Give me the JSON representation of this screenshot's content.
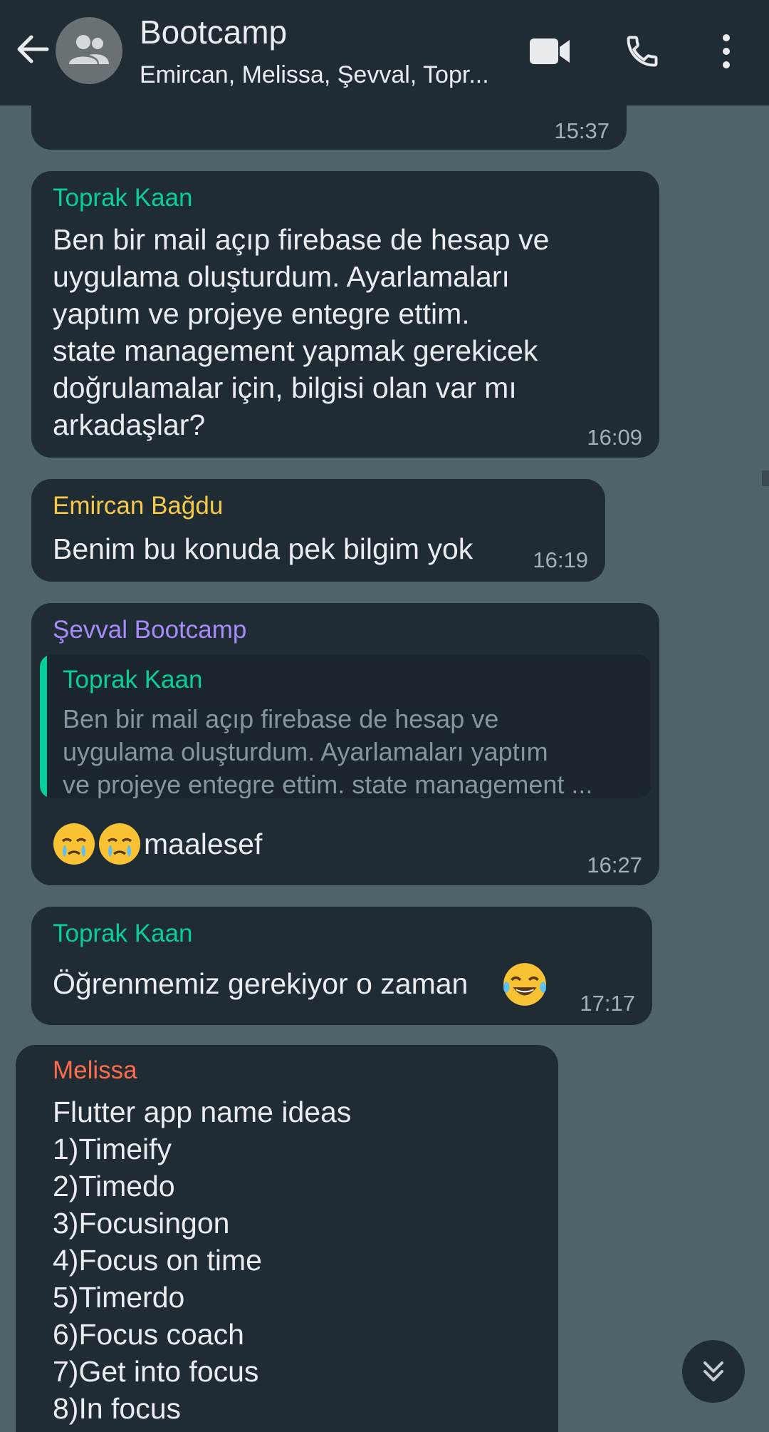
{
  "header": {
    "title": "Bootcamp",
    "subtitle": "Emircan, Melissa, Şevval, Topr...",
    "icons": [
      "back-arrow-icon",
      "group-avatar-icon",
      "video-call-icon",
      "phone-call-icon",
      "more-options-icon"
    ]
  },
  "messages": [
    {
      "time": "15:37"
    },
    {
      "sender": "Toprak Kaan",
      "sender_color": "#06cf9c",
      "text": "Ben bir mail açıp firebase de hesap ve\nuygulama oluşturdum. Ayarlamaları\nyaptım ve projeye entegre ettim.\nstate management yapmak gerekicek\ndoğrulamalar için, bilgisi olan var mı\narkadaşlar?",
      "time": "16:09"
    },
    {
      "sender": "Emircan Bağdu",
      "sender_color": "#f7c948",
      "text": "Benim bu konuda pek bilgim yok",
      "time": "16:19"
    },
    {
      "sender": "Şevval Bootcamp",
      "sender_color": "#a78bfa",
      "quote": {
        "sender": "Toprak Kaan",
        "text": "Ben bir mail açıp firebase de hesap ve\nuygulama oluşturdum. Ayarlamaları yaptım\nve projeye entegre ettim. state management ..."
      },
      "emojis": [
        "face-holding-back-tears-emoji",
        "face-holding-back-tears-emoji"
      ],
      "text": "maalesef",
      "time": "16:27"
    },
    {
      "sender": "Toprak Kaan",
      "sender_color": "#06cf9c",
      "text": "Öğrenmemiz gerekiyor o zaman",
      "emoji": "tears-of-joy-emoji",
      "time": "17:17"
    },
    {
      "sender": "Melissa",
      "sender_color": "#fc6b4a",
      "text": "Flutter app name ideas\n1)Timeify\n2)Timedo\n3)Focusingon\n4)Focus on time\n5)Timerdo\n6)Focus coach\n7)Get into focus\n8)In focus"
    }
  ],
  "colors": {
    "header_bg": "#1f2c34",
    "chat_bg": "#4f6466",
    "bubble_bg": "#1f2c34"
  },
  "scroll_button_icon": "double-chevron-down-icon"
}
